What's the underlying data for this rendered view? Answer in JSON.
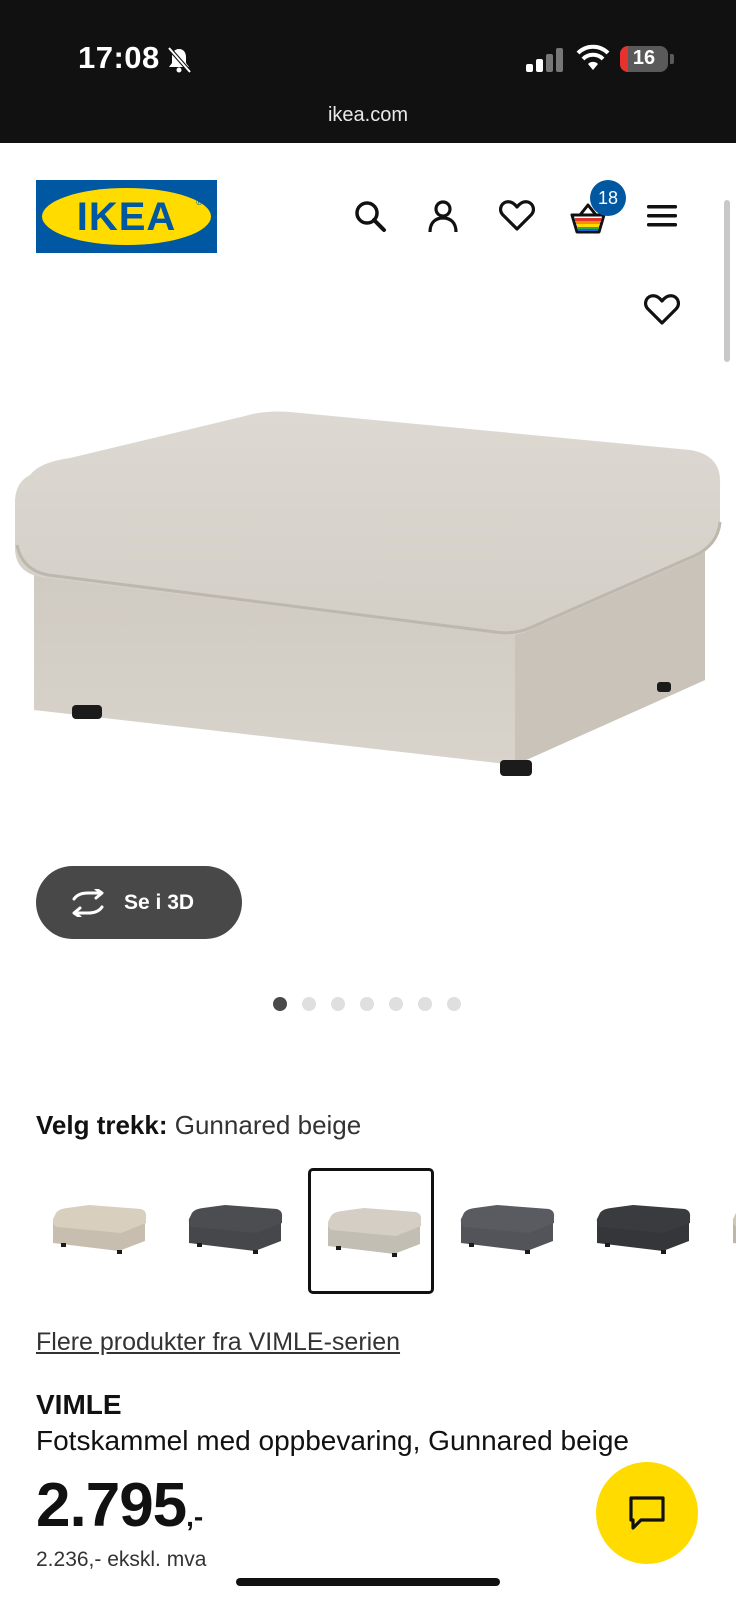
{
  "status_bar": {
    "time": "17:08",
    "battery": "16",
    "url": "ikea.com"
  },
  "header": {
    "logo_text": "IKEA",
    "logo_mark": "®",
    "cart_count": "18",
    "icons": [
      "search-icon",
      "account-icon",
      "heart-icon",
      "cart-icon",
      "menu-icon"
    ]
  },
  "gallery": {
    "view_3d_label": "Se i 3D",
    "dot_count": 7,
    "active_dot": 0
  },
  "variant": {
    "label": "Velg trekk:",
    "value": "Gunnared beige",
    "swatch_colors": [
      "#d9cfbf",
      "#4c4d50",
      "#d4cec4",
      "#595b61",
      "#3a3b3e",
      "#cfc6b5"
    ],
    "selected_index": 2
  },
  "product": {
    "series_link": "Flere produkter fra VIMLE-serien",
    "name": "VIMLE",
    "description": "Fotskammel med oppbevaring, Gunnared beige",
    "price_integer": "2.795",
    "price_suffix": ",-",
    "price_ex_vat": "2.236,- ekskl. mva"
  },
  "colors": {
    "ikea_blue": "#0058a3",
    "ikea_yellow": "#ffdb00",
    "fabric_beige": "#d6d1c8"
  }
}
